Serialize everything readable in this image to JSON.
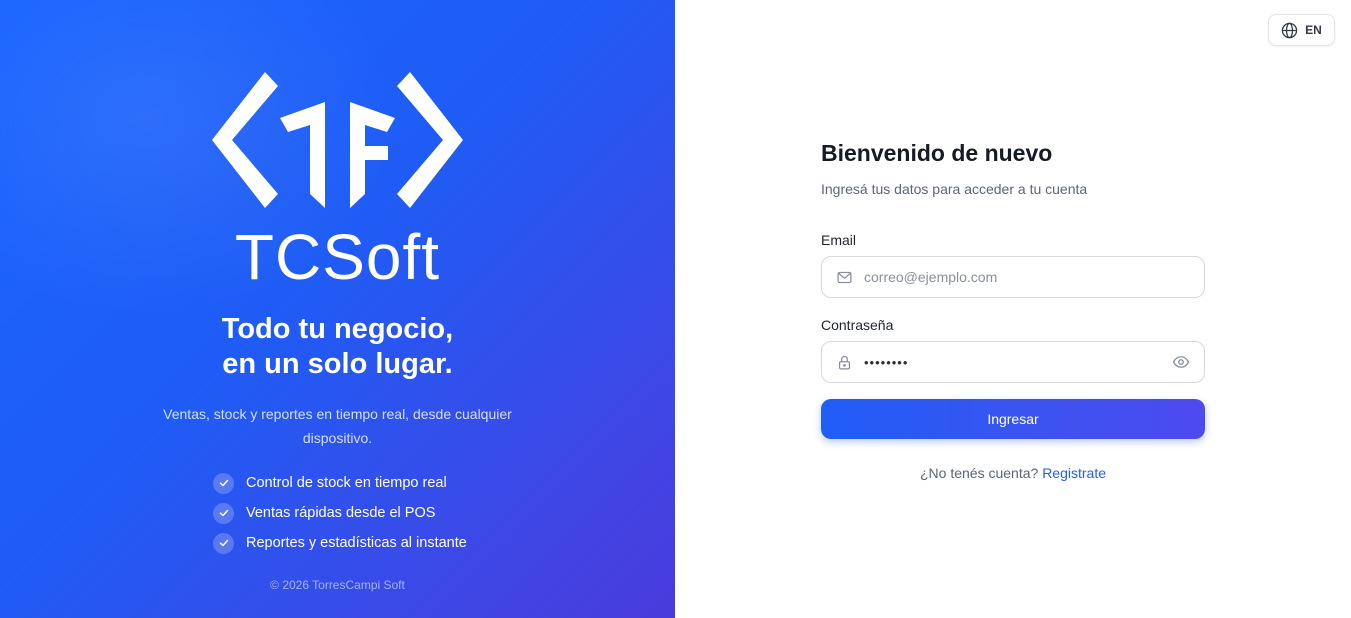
{
  "brand": {
    "name": "TCSoft",
    "headline_line1": "Todo tu negocio,",
    "headline_line2": "en un solo lugar.",
    "description": "Ventas, stock y reportes en tiempo real, desde cualquier dispositivo.",
    "features": [
      {
        "label": "Control de stock en tiempo real",
        "icon": "check-icon"
      },
      {
        "label": "Ventas rápidas desde el POS",
        "icon": "check-icon"
      },
      {
        "label": "Reportes y estadísticas al instante",
        "icon": "check-icon"
      }
    ],
    "copyright": "© 2026 TorresCampi Soft",
    "colors": {
      "gradient_start": "#1a66ff",
      "gradient_end": "#4a3bdc"
    }
  },
  "language": {
    "label": "EN",
    "icon": "globe-icon"
  },
  "login": {
    "title": "Bienvenido de nuevo",
    "subtitle": "Ingresá tus datos para acceder a tu cuenta",
    "email": {
      "label": "Email",
      "placeholder": "correo@ejemplo.com",
      "value": "",
      "icon": "mail-icon"
    },
    "password": {
      "label": "Contraseña",
      "value": "••••••••",
      "icon": "lock-icon",
      "toggle_icon": "eye-icon"
    },
    "submit_label": "Ingresar",
    "register_prompt": "¿No tenés cuenta?",
    "register_link": "Registrate",
    "colors": {
      "accent": "#1f5ef7"
    }
  }
}
